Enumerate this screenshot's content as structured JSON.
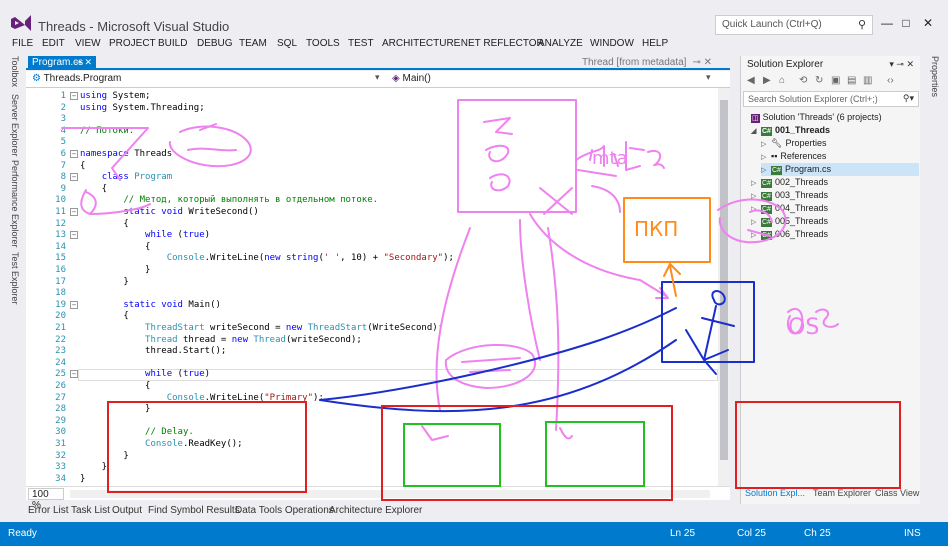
{
  "window": {
    "title": "Threads - Microsoft Visual Studio",
    "quick_launch_placeholder": "Quick Launch (Ctrl+Q)"
  },
  "menu": [
    "FILE",
    "EDIT",
    "VIEW",
    "PROJECT",
    "BUILD",
    "DEBUG",
    "TEAM",
    "SQL",
    "TOOLS",
    "TEST",
    "ARCHITECTURE",
    ".NET REFLECTOR",
    "ANALYZE",
    "WINDOW",
    "HELP"
  ],
  "left_tabs": [
    "Toolbox",
    "Server Explorer",
    "Performance Explorer",
    "Test Explorer"
  ],
  "editor": {
    "tab_label": "Program.cs",
    "meta_tab": "Thread [from metadata]",
    "nav_left": "Threads.Program",
    "nav_right": "Main()",
    "zoom": "100 %"
  },
  "code_lines": [
    {
      "n": "1",
      "text": "using System;"
    },
    {
      "n": "2",
      "text": "using System.Threading;"
    },
    {
      "n": "3",
      "text": ""
    },
    {
      "n": "4",
      "text": "// Потоки."
    },
    {
      "n": "5",
      "text": ""
    },
    {
      "n": "6",
      "text": "namespace Threads"
    },
    {
      "n": "7",
      "text": "{"
    },
    {
      "n": "8",
      "text": "    class Program"
    },
    {
      "n": "9",
      "text": "    {"
    },
    {
      "n": "10",
      "text": "        // Метод, который выполнять в отдельном потоке."
    },
    {
      "n": "11",
      "text": "        static void WriteSecond()"
    },
    {
      "n": "12",
      "text": "        {"
    },
    {
      "n": "13",
      "text": "            while (true)"
    },
    {
      "n": "14",
      "text": "            {"
    },
    {
      "n": "15",
      "text": "                Console.WriteLine(new string(' ', 10) + \"Secondary\");"
    },
    {
      "n": "16",
      "text": "            }"
    },
    {
      "n": "17",
      "text": "        }"
    },
    {
      "n": "18",
      "text": ""
    },
    {
      "n": "19",
      "text": "        static void Main()"
    },
    {
      "n": "20",
      "text": "        {"
    },
    {
      "n": "21",
      "text": "            ThreadStart writeSecond = new ThreadStart(WriteSecond);"
    },
    {
      "n": "22",
      "text": "            Thread thread = new Thread(writeSecond);"
    },
    {
      "n": "23",
      "text": "            thread.Start();"
    },
    {
      "n": "24",
      "text": ""
    },
    {
      "n": "25",
      "text": "            while (true)"
    },
    {
      "n": "26",
      "text": "            {"
    },
    {
      "n": "27",
      "text": "                Console.WriteLine(\"Primary\");"
    },
    {
      "n": "28",
      "text": "            }"
    },
    {
      "n": "29",
      "text": ""
    },
    {
      "n": "30",
      "text": "            // Delay."
    },
    {
      "n": "31",
      "text": "            Console.ReadKey();"
    },
    {
      "n": "32",
      "text": "        }"
    },
    {
      "n": "33",
      "text": "    }"
    },
    {
      "n": "34",
      "text": "}"
    }
  ],
  "bottom_tabs": [
    "Error List",
    "Task List",
    "Output",
    "Find Symbol Results",
    "Data Tools Operations",
    "Architecture Explorer"
  ],
  "solution_explorer": {
    "title": "Solution Explorer",
    "search_placeholder": "Search Solution Explorer (Ctrl+;)",
    "items": [
      {
        "label": "Solution 'Threads' (6 projects)",
        "icon": "solution-icon"
      },
      {
        "label": "001_Threads",
        "icon": "csharp-project-icon",
        "bold": true,
        "expanded": true
      },
      {
        "label": "Properties",
        "icon": "wrench-icon"
      },
      {
        "label": "References",
        "icon": "references-icon"
      },
      {
        "label": "Program.cs",
        "icon": "csharp-file-icon",
        "selected": true
      },
      {
        "label": "002_Threads",
        "icon": "csharp-project-icon"
      },
      {
        "label": "003_Threads",
        "icon": "csharp-project-icon"
      },
      {
        "label": "004_Threads",
        "icon": "csharp-project-icon"
      },
      {
        "label": "005_Threads",
        "icon": "csharp-project-icon"
      },
      {
        "label": "006_Threads",
        "icon": "csharp-project-icon"
      }
    ],
    "footer_tabs": [
      "Solution Expl...",
      "Team Explorer",
      "Class View"
    ]
  },
  "properties_tab": "Properties",
  "status": {
    "ready": "Ready",
    "ln": "Ln 25",
    "col": "Col 25",
    "ch": "Ch 25",
    "ins": "INS"
  },
  "annotations": {
    "mta": "mta",
    "pkp": "ПКП",
    "os": "OS"
  },
  "colors": {
    "accent": "#007acc",
    "ink_pink": "#ee82ee",
    "ink_blue": "#1a2ecc",
    "ink_orange": "#ff8c1a",
    "ink_red": "#e02020",
    "ink_green": "#22c022"
  }
}
